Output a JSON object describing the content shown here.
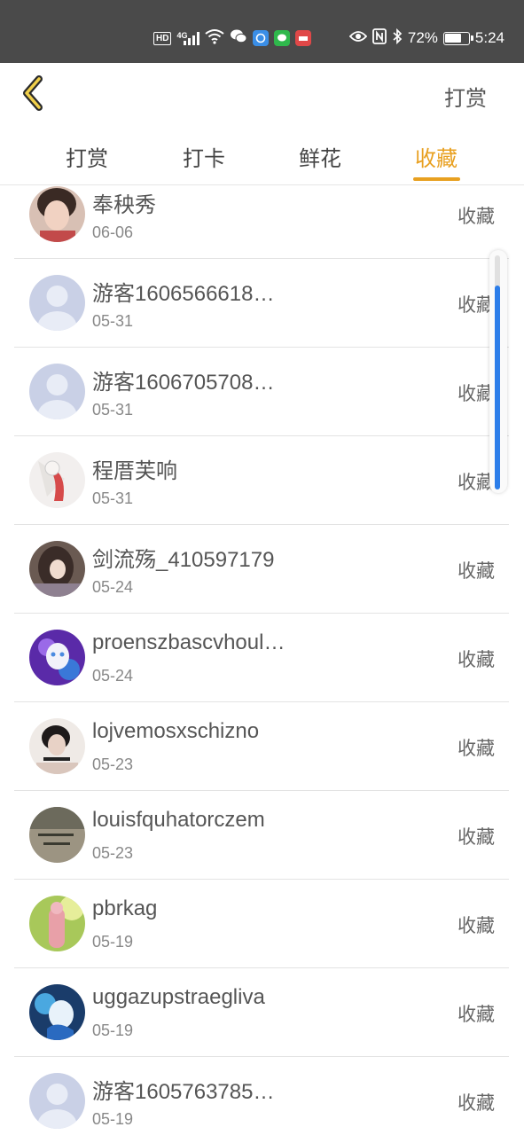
{
  "status_bar": {
    "hd": "HD",
    "network": "4G",
    "battery_percent": "72%",
    "battery_level": 0.72,
    "time": "5:24",
    "icons": [
      "wifi-icon",
      "wechat-icon",
      "app-icon",
      "line-icon",
      "shop-icon",
      "eye-icon",
      "nfc-icon",
      "bluetooth-icon"
    ]
  },
  "header": {
    "back_icon": "chevron-left-icon",
    "action_label": "打赏"
  },
  "tabs": [
    {
      "label": "打赏",
      "active": false
    },
    {
      "label": "打卡",
      "active": false
    },
    {
      "label": "鲜花",
      "active": false
    },
    {
      "label": "收藏",
      "active": true
    }
  ],
  "colors": {
    "accent": "#e8a020",
    "status_bar": "#4a4a4a",
    "scroll_thumb": "#2b7de9"
  },
  "list": [
    {
      "name": "奉秧秀",
      "date": "06-06",
      "action": "收藏",
      "avatar": "photo"
    },
    {
      "name": "游客1606566618…",
      "date": "05-31",
      "action": "收藏",
      "avatar": "default"
    },
    {
      "name": "游客1606705708…",
      "date": "05-31",
      "action": "收藏",
      "avatar": "default"
    },
    {
      "name": "程厝芙响",
      "date": "05-31",
      "action": "收藏",
      "avatar": "photo"
    },
    {
      "name": "剑流殇_410597179",
      "date": "05-24",
      "action": "收藏",
      "avatar": "photo"
    },
    {
      "name": "proenszbascvhoul…",
      "date": "05-24",
      "action": "收藏",
      "avatar": "photo"
    },
    {
      "name": "lojvemosxschizno",
      "date": "05-23",
      "action": "收藏",
      "avatar": "photo"
    },
    {
      "name": "louisfquhatorczem",
      "date": "05-23",
      "action": "收藏",
      "avatar": "photo"
    },
    {
      "name": "pbrkag",
      "date": "05-19",
      "action": "收藏",
      "avatar": "photo"
    },
    {
      "name": "uggazupstraegliva",
      "date": "05-19",
      "action": "收藏",
      "avatar": "photo"
    },
    {
      "name": "游客1605763785…",
      "date": "05-19",
      "action": "收藏",
      "avatar": "default"
    }
  ]
}
